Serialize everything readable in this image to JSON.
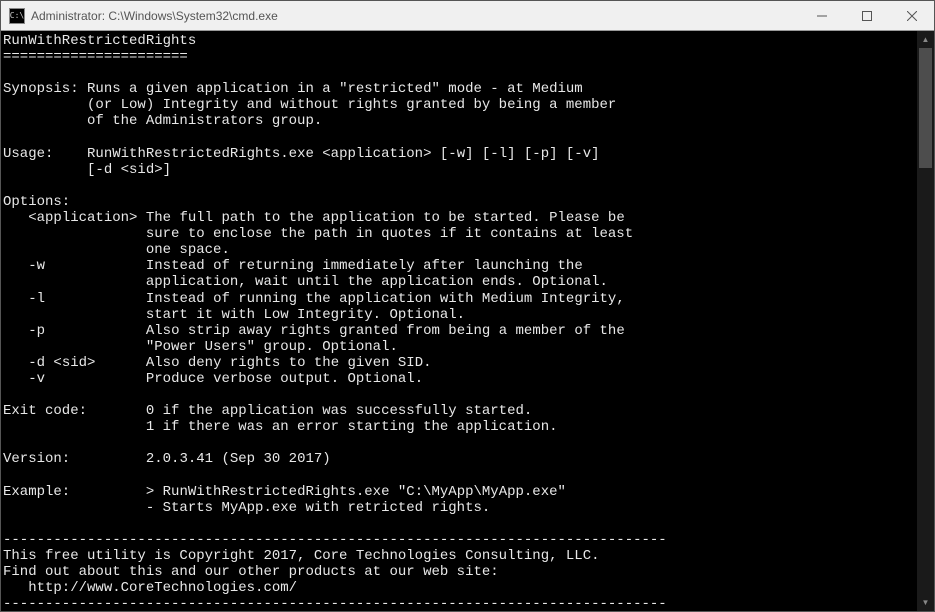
{
  "window": {
    "title": "Administrator: C:\\Windows\\System32\\cmd.exe",
    "icon_text": "C:\\"
  },
  "console": {
    "heading": "RunWithRestrictedRights",
    "heading_underline": "======================",
    "synopsis_label": "Synopsis:",
    "synopsis_line1": "Runs a given application in a \"restricted\" mode - at Medium",
    "synopsis_line2": "(or Low) Integrity and without rights granted by being a member",
    "synopsis_line3": "of the Administrators group.",
    "usage_label": "Usage:",
    "usage_line1": "RunWithRestrictedRights.exe <application> [-w] [-l] [-p] [-v]",
    "usage_line2": "[-d <sid>]",
    "options_label": "Options:",
    "opt_application_flag": "<application>",
    "opt_application_l1": "The full path to the application to be started. Please be",
    "opt_application_l2": "sure to enclose the path in quotes if it contains at least",
    "opt_application_l3": "one space.",
    "opt_w_flag": "-w",
    "opt_w_l1": "Instead of returning immediately after launching the",
    "opt_w_l2": "application, wait until the application ends. Optional.",
    "opt_l_flag": "-l",
    "opt_l_l1": "Instead of running the application with Medium Integrity,",
    "opt_l_l2": "start it with Low Integrity. Optional.",
    "opt_p_flag": "-p",
    "opt_p_l1": "Also strip away rights granted from being a member of the",
    "opt_p_l2": "\"Power Users\" group. Optional.",
    "opt_d_flag": "-d <sid>",
    "opt_d_l1": "Also deny rights to the given SID.",
    "opt_v_flag": "-v",
    "opt_v_l1": "Produce verbose output. Optional.",
    "exitcode_label": "Exit code:",
    "exitcode_l1": "0 if the application was successfully started.",
    "exitcode_l2": "1 if there was an error starting the application.",
    "version_label": "Version:",
    "version_value": "2.0.3.41 (Sep 30 2017)",
    "example_label": "Example:",
    "example_l1": "> RunWithRestrictedRights.exe \"C:\\MyApp\\MyApp.exe\"",
    "example_l2": "- Starts MyApp.exe with retricted rights.",
    "dashline": "-------------------------------------------------------------------------------",
    "copyright_l1": "This free utility is Copyright 2017, Core Technologies Consulting, LLC.",
    "copyright_l2": "Find out about this and our other products at our web site:",
    "copyright_l3": "   http://www.CoreTechnologies.com/"
  }
}
